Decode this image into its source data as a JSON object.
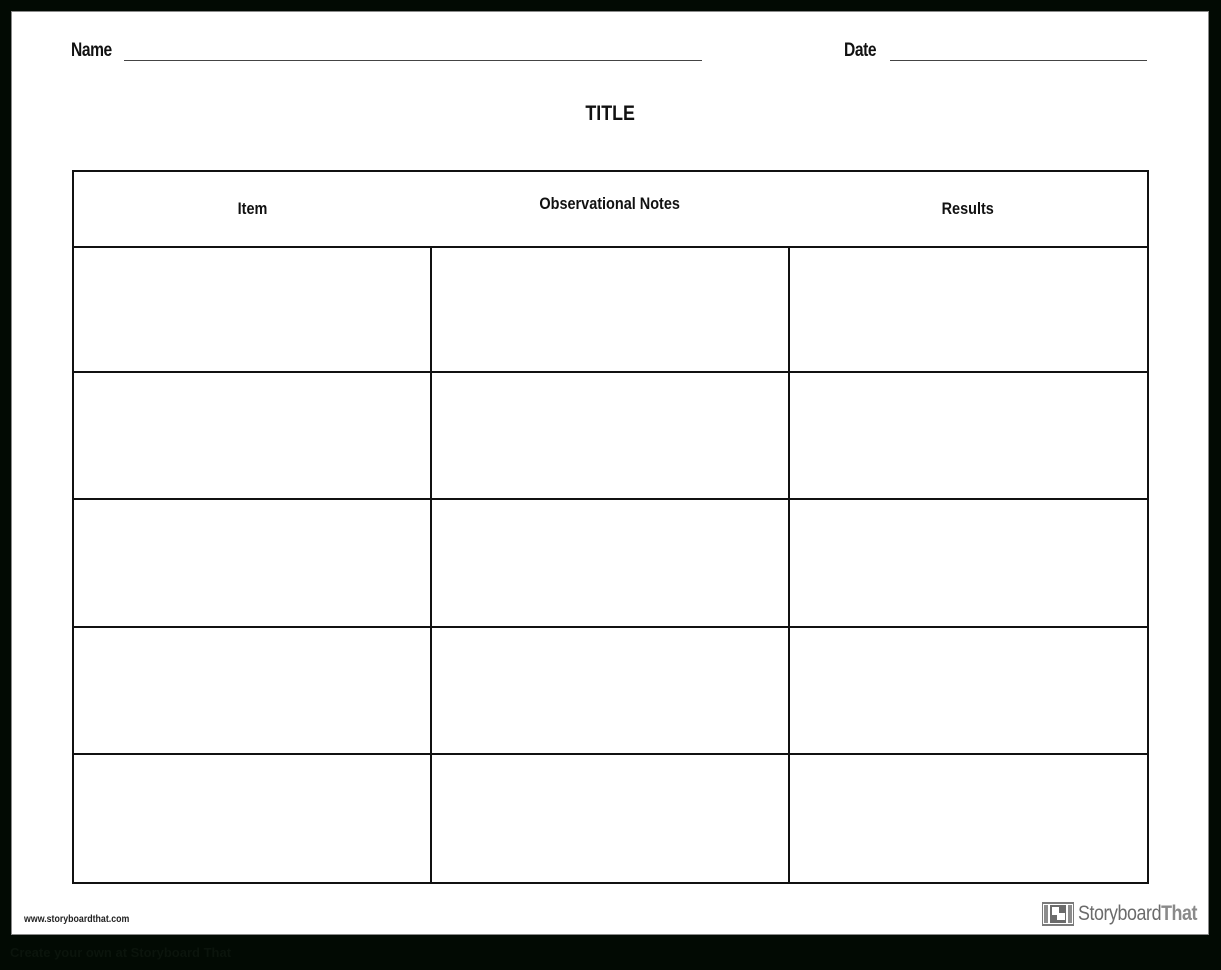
{
  "header": {
    "name_label": "Name",
    "date_label": "Date",
    "name_value": "",
    "date_value": ""
  },
  "title": "TITLE",
  "table": {
    "columns": [
      "Item",
      "Observational Notes",
      "Results"
    ],
    "rows": [
      [
        "",
        "",
        ""
      ],
      [
        "",
        "",
        ""
      ],
      [
        "",
        "",
        ""
      ],
      [
        "",
        "",
        ""
      ],
      [
        "",
        "",
        ""
      ]
    ]
  },
  "footer": {
    "url": "www.storyboardthat.com",
    "logo_text_main": "Storyboard",
    "logo_text_accent": "That",
    "caption": "Create your own at Storyboard That"
  },
  "colors": {
    "background": "#020a03",
    "sheet": "#ffffff",
    "ink": "#111111",
    "logo_gray": "#6b6b6b"
  }
}
